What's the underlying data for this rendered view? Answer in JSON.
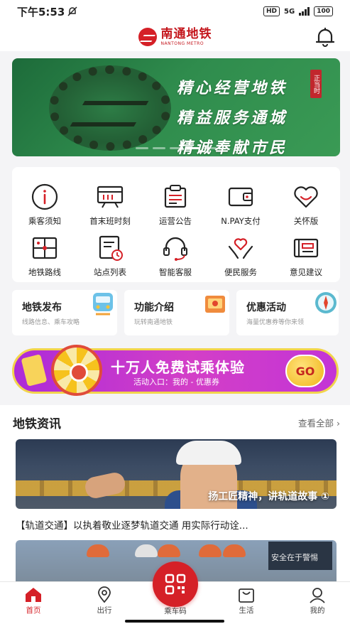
{
  "status_bar": {
    "time": "下午5:53",
    "hd": "HD",
    "network": "5G",
    "battery": "100"
  },
  "header": {
    "logo_cn": "南通地铁",
    "logo_en": "NANTONG METRO"
  },
  "banner": {
    "lines": [
      "精心经营地铁",
      "精益服务通城",
      "精诚奉献市民"
    ],
    "seal": "正当时"
  },
  "services": [
    {
      "label": "乘客须知",
      "icon": "info-icon"
    },
    {
      "label": "首末班时刻",
      "icon": "timetable-icon"
    },
    {
      "label": "运营公告",
      "icon": "announcement-icon"
    },
    {
      "label": "N.PAY支付",
      "icon": "wallet-icon"
    },
    {
      "label": "关怀版",
      "icon": "heart-icon"
    },
    {
      "label": "地铁路线",
      "icon": "route-map-icon"
    },
    {
      "label": "站点列表",
      "icon": "station-list-icon"
    },
    {
      "label": "智能客服",
      "icon": "headset-icon"
    },
    {
      "label": "便民服务",
      "icon": "hands-heart-icon"
    },
    {
      "label": "意见建议",
      "icon": "feedback-icon"
    }
  ],
  "quick_cards": [
    {
      "title": "地铁发布",
      "subtitle": "线路信息、乘车攻略",
      "icon": "train-icon"
    },
    {
      "title": "功能介绍",
      "subtitle": "玩转南通地铁",
      "icon": "gift-icon"
    },
    {
      "title": "优惠活动",
      "subtitle": "海量优惠券等你来领",
      "icon": "compass-icon"
    }
  ],
  "promo": {
    "title": "十万人免费试乘体验",
    "subtitle": "活动入口：我的 - 优惠券",
    "button": "GO"
  },
  "news": {
    "section_title": "地铁资讯",
    "more": "查看全部",
    "image_caption": "扬工匠精神，讲轨道故事 ①",
    "headline": "【轨道交通】以执着敬业逐梦轨道交通 用实际行动诠...",
    "second_sign": "安全在于警惕"
  },
  "tabs": [
    {
      "label": "首页",
      "icon": "home-icon"
    },
    {
      "label": "出行",
      "icon": "travel-icon"
    },
    {
      "label": "乘车码",
      "icon": "qr-code-icon"
    },
    {
      "label": "生活",
      "icon": "life-icon"
    },
    {
      "label": "我的",
      "icon": "profile-icon"
    }
  ],
  "colors": {
    "brand_red": "#d52027",
    "promo_purple": "#ad2bd8",
    "banner_green": "#2f8c4d"
  }
}
